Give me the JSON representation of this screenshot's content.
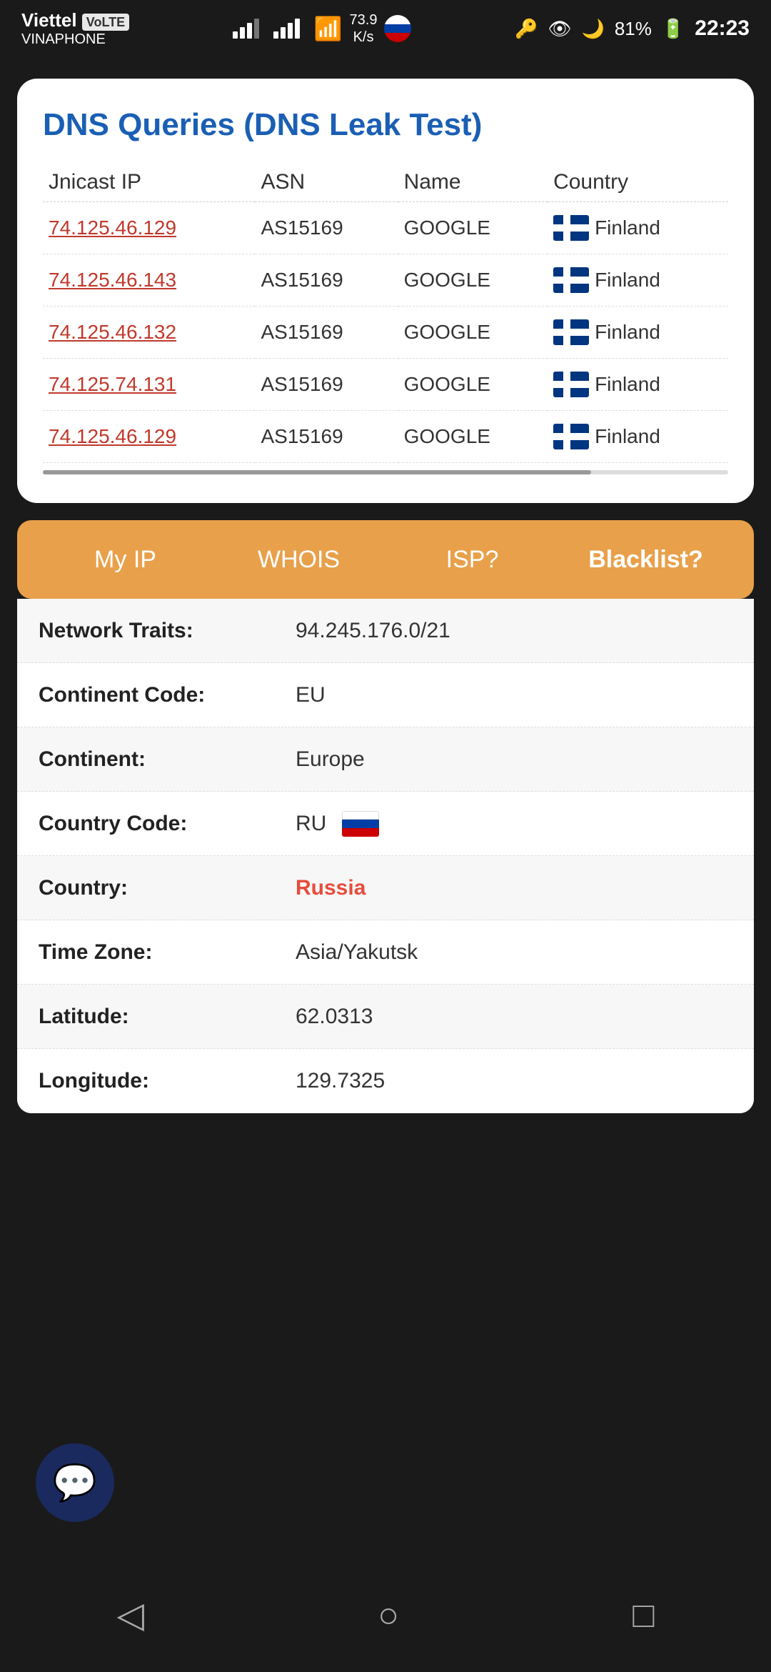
{
  "statusBar": {
    "carrier": "Viettel",
    "network_badge": "VoLTE",
    "provider": "VINAPHONE",
    "speed": "73.9\nK/s",
    "battery": "81%",
    "time": "22:23"
  },
  "dnsCard": {
    "title": "DNS Queries (DNS Leak Test)",
    "columns": [
      "Jnicast IP",
      "ASN",
      "Name",
      "Country"
    ],
    "rows": [
      {
        "ip": "74.125.46.129",
        "asn": "AS15169",
        "name": "GOOGLE",
        "country": "Finland"
      },
      {
        "ip": "74.125.46.143",
        "asn": "AS15169",
        "name": "GOOGLE",
        "country": "Finland"
      },
      {
        "ip": "74.125.46.132",
        "asn": "AS15169",
        "name": "GOOGLE",
        "country": "Finland"
      },
      {
        "ip": "74.125.74.131",
        "asn": "AS15169",
        "name": "GOOGLE",
        "country": "Finland"
      },
      {
        "ip": "74.125.46.129",
        "asn": "AS15169",
        "name": "GOOGLE",
        "country": "Finland"
      }
    ]
  },
  "navTabs": {
    "tabs": [
      "My IP",
      "WHOIS",
      "ISP?",
      "Blacklist?"
    ],
    "activeTab": "My IP"
  },
  "infoRows": [
    {
      "label": "Network Traits:",
      "value": "94.245.176.0/21"
    },
    {
      "label": "Continent Code:",
      "value": "EU"
    },
    {
      "label": "Continent:",
      "value": "Europe"
    },
    {
      "label": "Country Code:",
      "value": "RU",
      "hasFlag": true
    },
    {
      "label": "Country:",
      "value": "Russia",
      "isHighlight": true
    },
    {
      "label": "Time Zone:",
      "value": "Asia/Yakutsk"
    },
    {
      "label": "Latitude:",
      "value": "62.0313"
    },
    {
      "label": "Longitude:",
      "value": "129.7325"
    }
  ]
}
